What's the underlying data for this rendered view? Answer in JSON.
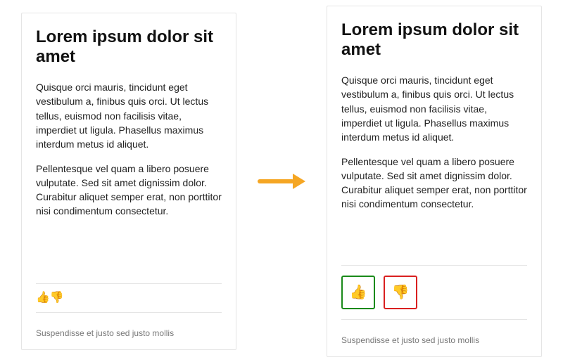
{
  "cards": {
    "before": {
      "title": "Lorem ipsum dolor sit amet",
      "para1": "Quisque orci mauris, tincidunt eget vestibulum a, finibus quis orci. Ut lectus tellus, euismod non facilisis vitae, imperdiet ut ligula. Phasellus maximus interdum metus id aliquet.",
      "para2": "Pellentesque vel quam a libero posuere vulputate. Sed sit amet dignissim dolor. Curabitur aliquet semper erat, non porttitor nisi condimentum consectetur.",
      "thumbs_up": "👍",
      "thumbs_down": "👎",
      "footer": "Suspendisse et justo sed justo mollis"
    },
    "after": {
      "title": "Lorem ipsum dolor sit amet",
      "para1": "Quisque orci mauris, tincidunt eget vestibulum a, finibus quis orci. Ut lectus tellus, euismod non facilisis vitae, imperdiet ut ligula. Phasellus maximus interdum metus id aliquet.",
      "para2": "Pellentesque vel quam a libero posuere vulputate. Sed sit amet dignissim dolor. Curabitur aliquet semper erat, non porttitor nisi condimentum consectetur.",
      "thumbs_up": "👍",
      "thumbs_down": "👎",
      "footer": "Suspendisse et justo sed justo mollis"
    }
  }
}
